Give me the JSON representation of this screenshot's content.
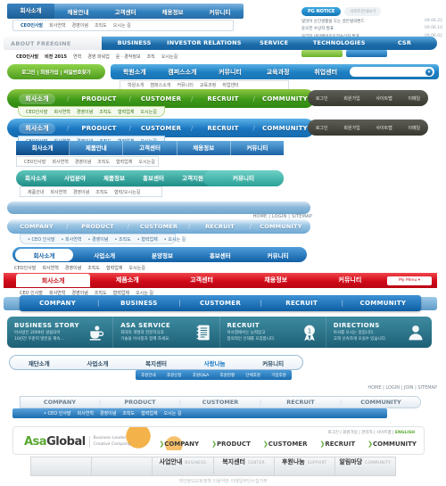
{
  "bar1": {
    "items": [
      "회사소개",
      "채용안내",
      "고객센터",
      "채용정보",
      "커뮤니티"
    ],
    "active": "회사소개",
    "sub": [
      "CEO인사말",
      "회사연혁",
      "경영이념",
      "조직도",
      "오시는 길"
    ]
  },
  "notice": {
    "badge": "PG NOTICE",
    "more": "사이트안내보기",
    "items": [
      {
        "text": "빛맛이 순간생활을 도는 골든빌의뻔드",
        "date": "09.06.22"
      },
      {
        "text": "윤오전 수상자 발표",
        "date": "09.06.10"
      },
      {
        "text": "우리진 네이벤비유모전수상자 발표",
        "date": "09.06.02"
      }
    ]
  },
  "bar2": {
    "label": "ABOUT FREEGINE",
    "items": [
      "BUSINESS",
      "INVESTOR RELATIONS",
      "SERVICE",
      "TECHNOLOGIES",
      "CSR"
    ],
    "sub": [
      "CEO인사말",
      "비전 2015",
      "연혁",
      "경영 파워업",
      "윤 · 경작정보",
      "조직",
      "오시는길"
    ]
  },
  "bar3": {
    "login": "로그인 | 회원가입 | 비밀번호찾기",
    "items": [
      "학원소개",
      "캠퍼스소개",
      "커뮤니티",
      "교육과정",
      "취업센터"
    ],
    "search_placeholder": "",
    "search_icon": "chevron-down-icon",
    "sub": [
      "학원소개",
      "캠퍼스소개",
      "커뮤니티",
      "교육과정",
      "취업센터"
    ]
  },
  "bar4": {
    "items": [
      "회사소개",
      "PRODUCT",
      "CUSTOMER",
      "RECRUIT",
      "COMMUNITY"
    ],
    "active": "회사소개",
    "util": [
      "로그인",
      "회원가입",
      "사이트맵",
      "이메일"
    ],
    "sub": [
      "CEO인사말",
      "회사연혁",
      "경영이념",
      "조직도",
      "협력업체",
      "오시는길"
    ]
  },
  "bar5": {
    "items": [
      "회사소개",
      "PRODUCT",
      "CUSTOMER",
      "RECRUIT",
      "COMMUNITY"
    ],
    "active": "회사소개",
    "util": [
      "로그인",
      "회원가입",
      "사이트맵",
      "이메일"
    ],
    "sub": [
      "CEO인사말",
      "회사연혁",
      "경영이념",
      "조직도",
      "협력업체",
      "오시는길"
    ]
  },
  "bar6": {
    "items": [
      "회사소개",
      "제품안내",
      "고객센터",
      "채용정보",
      "커뮤니티"
    ],
    "active": "회사소개",
    "sub": [
      "CEO인사말",
      "회사연혁",
      "경영이념",
      "조직도",
      "협력업체",
      "오시는길"
    ]
  },
  "bar7": {
    "items": [
      "회사소개",
      "사업분야",
      "제품정보",
      "홍보센터",
      "고객지원"
    ],
    "tail": "커뮤니티",
    "sub": [
      "제품안내",
      "회사연혁",
      "경영이념",
      "조직도",
      "협력/오시는길"
    ]
  },
  "bar8": {
    "links": "HOME  |  LOGIN  |  SITEMAP"
  },
  "bar9": {
    "items": [
      "COMPANY",
      "PRODUCT",
      "CUSTOMER",
      "RECRUIT",
      "COMMUNITY"
    ],
    "sub": [
      "• CEO 인사말",
      "• 회사연혁",
      "• 경영이념",
      "• 조직도",
      "• 협력업체",
      "• 오시는 길"
    ]
  },
  "bar10": {
    "items": [
      "회사소개",
      "사업소개",
      "분양정보",
      "홍보센터",
      "커뮤니티"
    ],
    "active": "회사소개",
    "sub": [
      "CEO인사말",
      "회사연혁",
      "경영이념",
      "조직도",
      "협력업체",
      "오시는길"
    ]
  },
  "bar11": {
    "items": [
      "회사소개",
      "제품소개",
      "고객센터",
      "채용정보",
      "커뮤니티"
    ],
    "active": "회사소개",
    "mymenu": "My Menu ▾",
    "sub": [
      "CEO 인사말",
      "회사연혁",
      "경영이념",
      "조직도",
      "협력업체",
      "오시는 길"
    ]
  },
  "bar12": {
    "items": [
      "COMPANY",
      "BUSINESS",
      "CUSTOMER",
      "RECRUIT",
      "COMMUNITY"
    ]
  },
  "panel13": {
    "cards": [
      {
        "title": "BUSINESS STORY",
        "desc": "아사방은 2009년 설립되어\n10년간 꾸준히 발전을 계속...",
        "icon": "coffee-cup-icon"
      },
      {
        "title": "ASA SERVICE",
        "desc": "최대의 개발과 전문지식과\n기술을 아사정과 함께 하세요.",
        "icon": "notebook-icon"
      },
      {
        "title": "RECRUIT",
        "desc": "아사엠에서는 능력있고\n창의적인 인재를 모집합니다.",
        "icon": "award-medal-icon"
      },
      {
        "title": "DIRECTIONS",
        "desc": "아사를 오시는 길입니다.\n고객 신속하게 모실수 있습니다.",
        "icon": "person-icon"
      }
    ]
  },
  "bar14": {
    "items": [
      "재단소개",
      "사업소개",
      "복지센터",
      "사랑나눔",
      "커뮤니티"
    ],
    "active": "사랑나눔",
    "sub": [
      "후원안내",
      "후원신청",
      "후원Q&A",
      "후원현황",
      "단체후원",
      "기업후원"
    ]
  },
  "bar15": {
    "links": "HOME  |  LOGIN  |  JOIN  |  SITEMAP"
  },
  "bar16": {
    "items": [
      "COMPANY",
      "PRODUCT",
      "CUSTOMER",
      "RECRUIT",
      "COMMUNITY"
    ],
    "sub": [
      "• CEO 인사말",
      "회사연혁",
      "경영이념",
      "조직도",
      "협력업체",
      "오시는 길"
    ]
  },
  "header17": {
    "brand_a": "Asa",
    "brand_b": "Global",
    "tagline": "Business Leader\nCreative Company",
    "toplinks": "로그인 | 회원가입 | 관리자 | 사이트맵 | ",
    "toplinks_en": "ENGLISH",
    "nav": [
      "COMPANY",
      "PRODUCT",
      "CUSTOMER",
      "RECRUIT",
      "COMMUNITY"
    ],
    "nav_arrow": "❯"
  },
  "strip18": {
    "tabs": [
      {
        "kr": "",
        "en": ""
      },
      {
        "kr": "",
        "en": ""
      },
      {
        "kr": "사업안내",
        "en": "BUSINESS"
      },
      {
        "kr": "복지센터",
        "en": "CENTER"
      },
      {
        "kr": "후원나눔",
        "en": "SUPPORT"
      },
      {
        "kr": "알림마당",
        "en": "COMMUNITY"
      }
    ],
    "footer": "개인정보보호정책   이용약관   이메일무단수집거부"
  },
  "colors": {
    "blue": "#1b6aa8",
    "green": "#4e9c1e",
    "red": "#cf0a18",
    "teal": "#1d8d86",
    "dark": "#38382f"
  }
}
